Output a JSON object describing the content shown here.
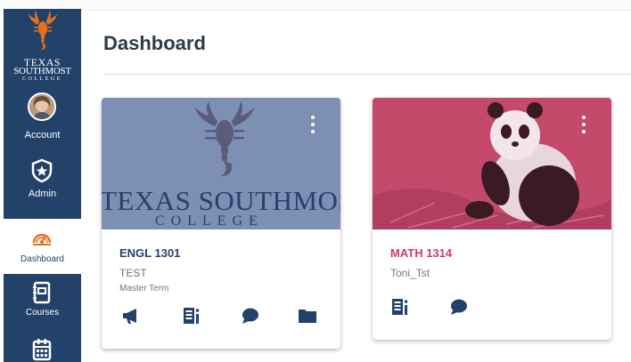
{
  "brand": {
    "line1": "TEXAS",
    "line2": "SOUTHMOST",
    "line3": "COLLEGE"
  },
  "nav": {
    "account": "Account",
    "admin": "Admin",
    "dashboard": "Dashboard",
    "courses": "Courses"
  },
  "page": {
    "title": "Dashboard"
  },
  "cards": [
    {
      "code": "ENGL 1301",
      "name": "TEST",
      "term": "Master Term",
      "code_color": "#22426a",
      "hero_color": "#7d8fb3",
      "hero_brand": "TEXAS SOUTHMOS",
      "hero_college": "COLLEGE"
    },
    {
      "code": "MATH 1314",
      "name": "Toni_Tst",
      "code_color": "#d2386c",
      "hero_color": "#c44a6c"
    }
  ],
  "icons": {
    "sidebar": [
      "scorpion-logo-icon",
      "avatar",
      "shield-star-icon",
      "speedometer-icon",
      "notebook-icon",
      "calendar-icon"
    ],
    "card1": [
      "megaphone-icon",
      "assignments-icon",
      "discussions-icon",
      "folder-icon"
    ],
    "card2": [
      "assignments-icon",
      "discussions-icon"
    ]
  },
  "colors": {
    "sidebar": "#22426a",
    "accent_orange": "#e8701a"
  }
}
